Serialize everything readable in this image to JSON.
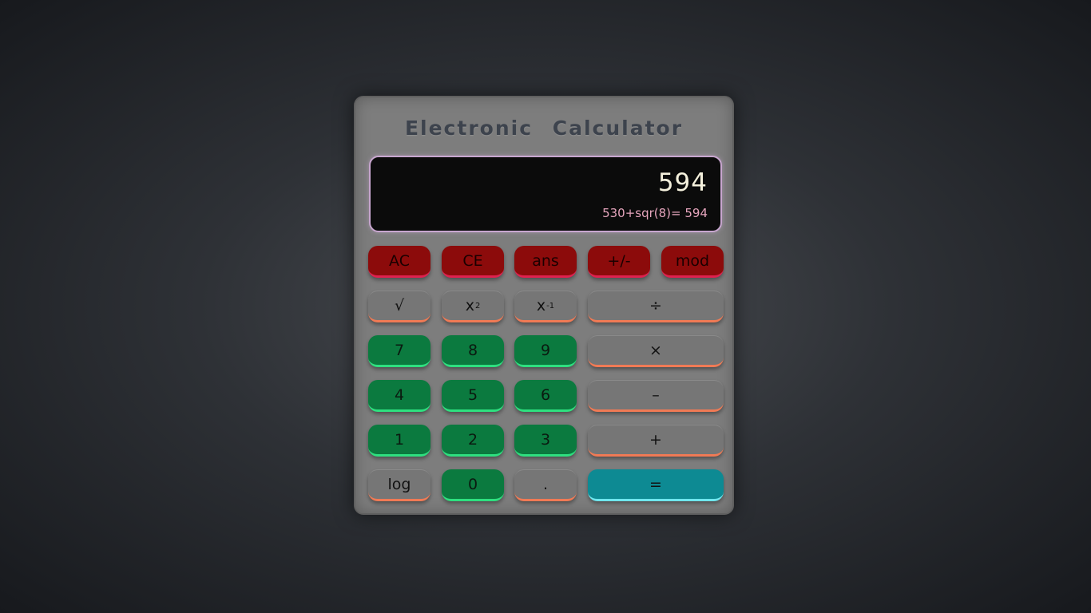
{
  "title": "Electronic   Calculator",
  "display": {
    "result": "594",
    "expression": "530+sqr(8)= 594"
  },
  "keys": {
    "ac": "AC",
    "ce": "CE",
    "ans": "ans",
    "plus_minus": "+/-",
    "mod": "mod",
    "sqrt": "√",
    "square_base": "x",
    "square_exp": "2",
    "inverse_base": "x",
    "inverse_exp": "-1",
    "divide": "÷",
    "seven": "7",
    "eight": "8",
    "nine": "9",
    "multiply": "×",
    "four": "4",
    "five": "5",
    "six": "6",
    "minus": "–",
    "one": "1",
    "two": "2",
    "three": "3",
    "plus": "+",
    "log": "log",
    "zero": "0",
    "decimal": ".",
    "equals": "="
  },
  "colors": {
    "function_red": "#8c0b0b",
    "number_green": "#0b7a3f",
    "operator_gray": "#767676",
    "equals_teal": "#0d8a93",
    "display_border": "#c8a6cf"
  }
}
